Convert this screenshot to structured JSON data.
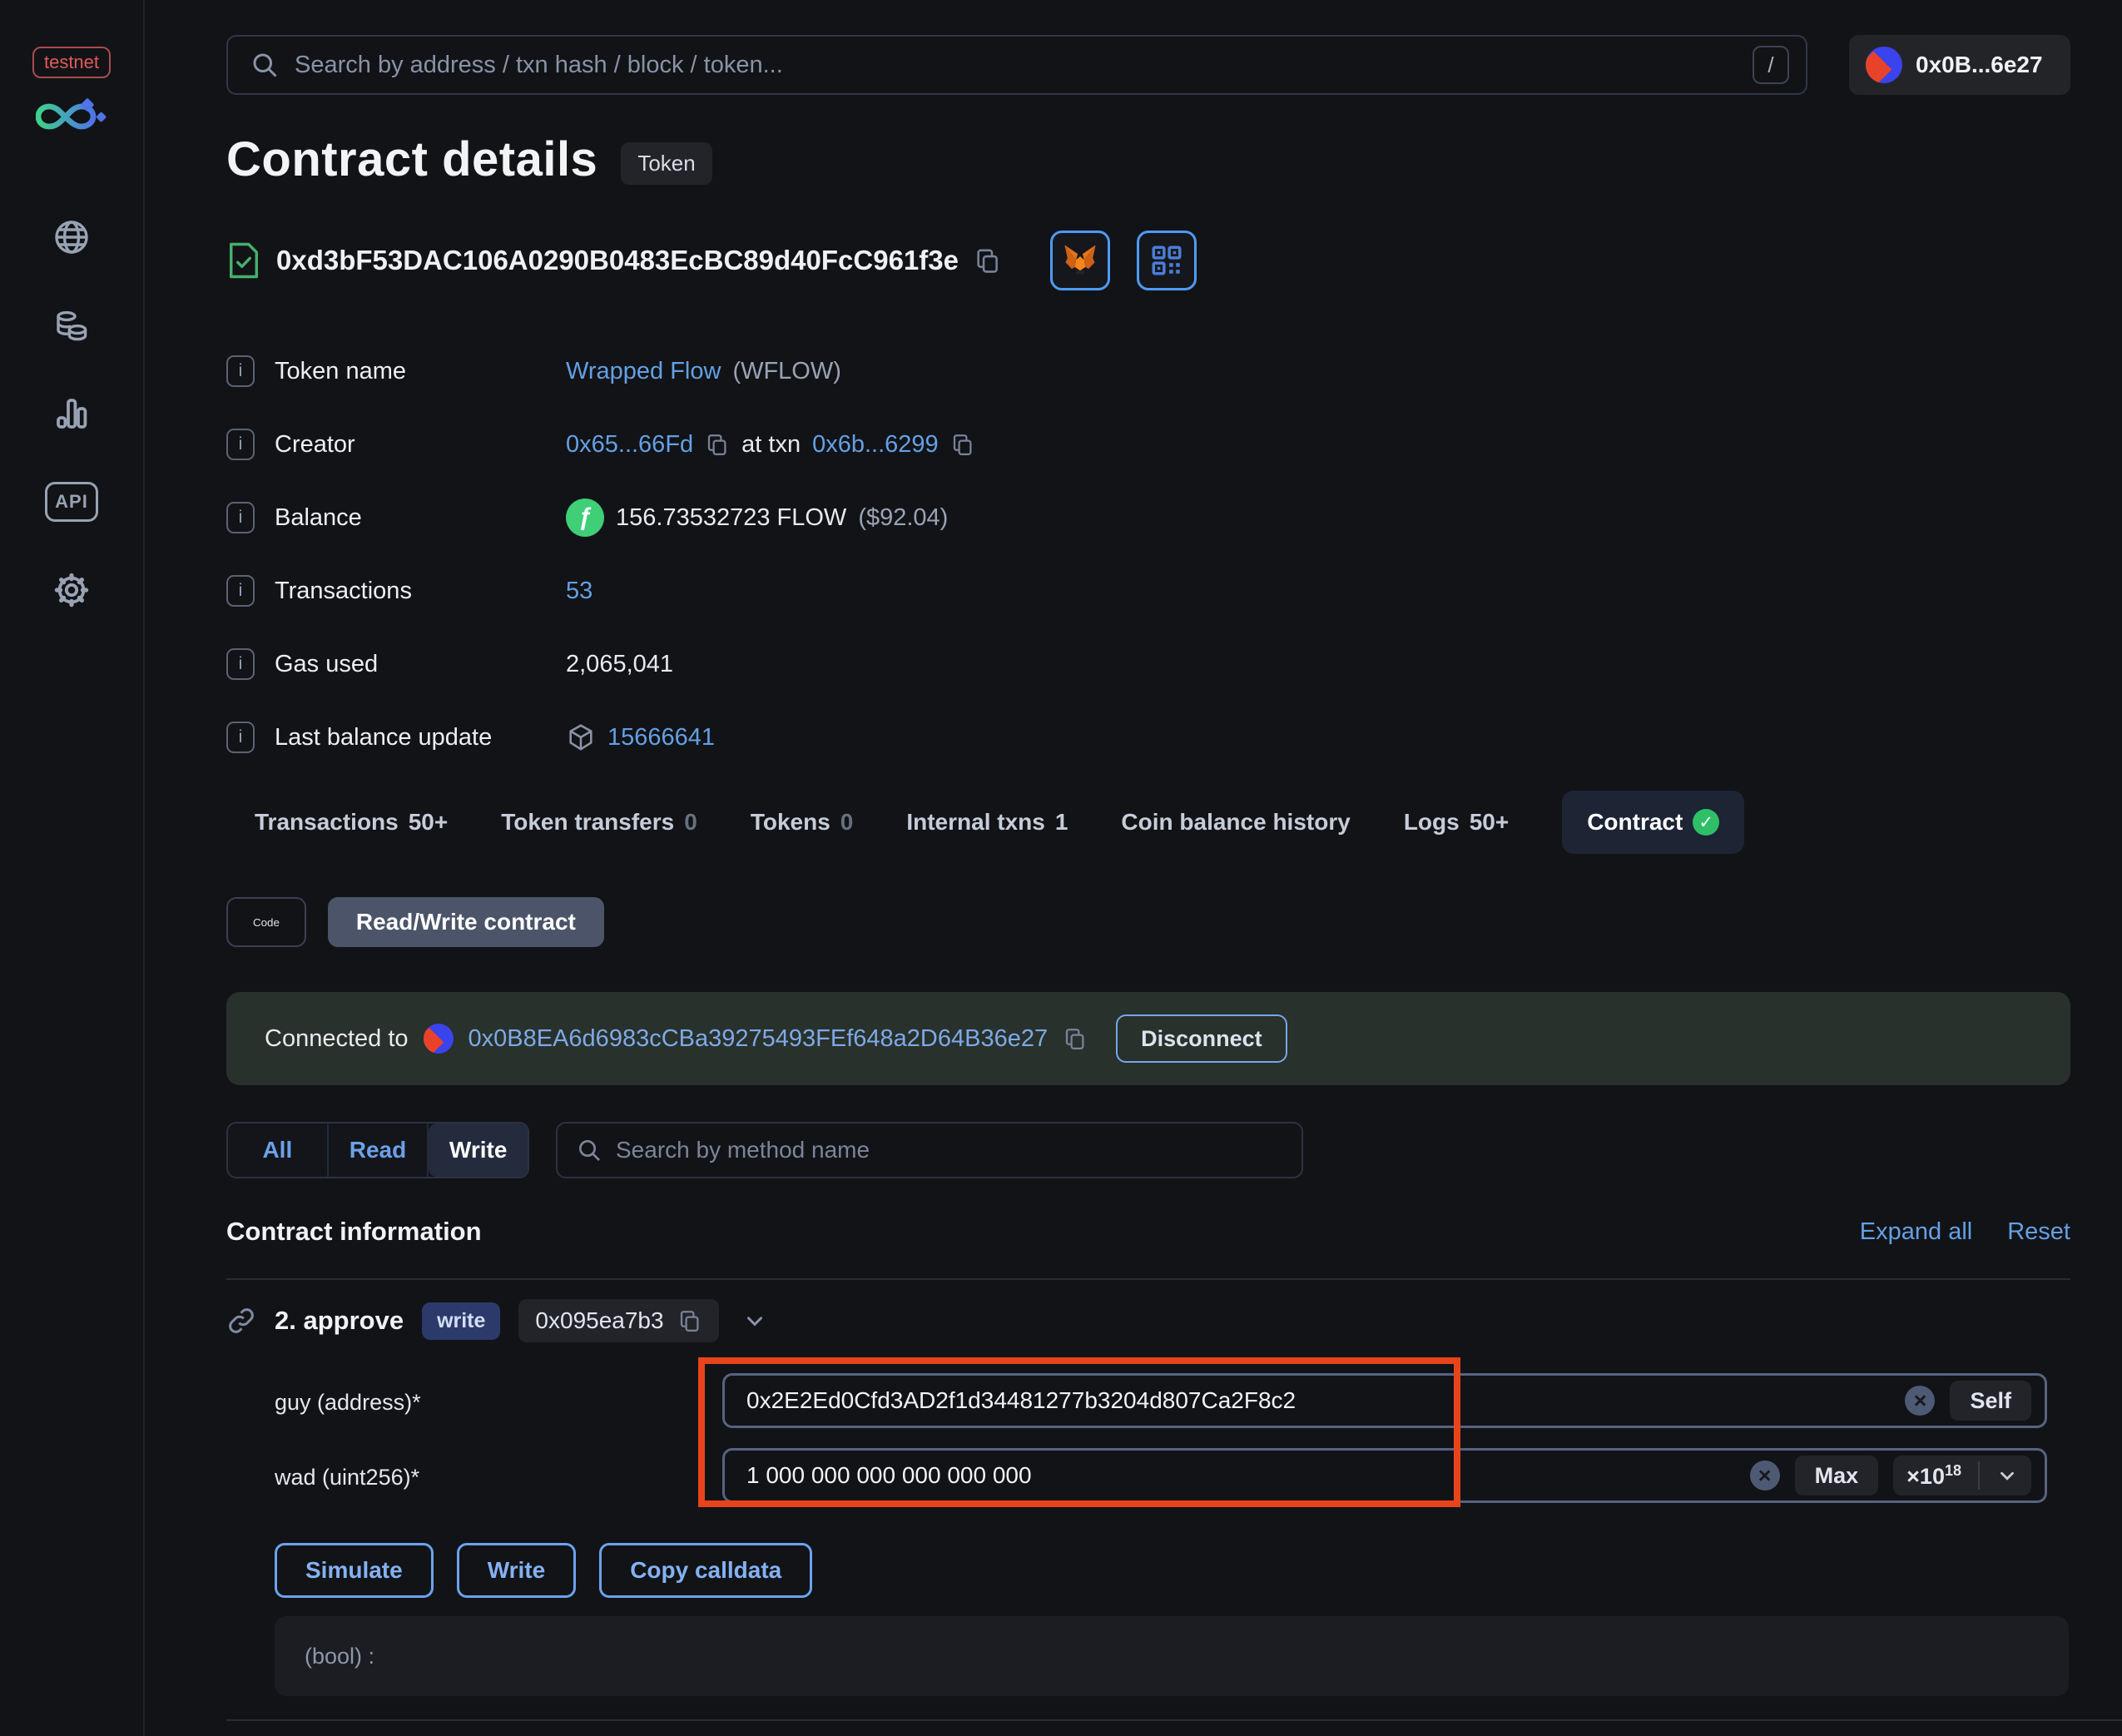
{
  "sidebar": {
    "network_badge": "testnet",
    "api_label": "API"
  },
  "topbar": {
    "search_placeholder": "Search by address / txn hash / block / token...",
    "shortcut_key": "/",
    "account_label": "0x0B...6e27"
  },
  "header": {
    "title": "Contract details",
    "badge": "Token",
    "address": "0xd3bF53DAC106A0290B0483EcBC89d40FcC961f3e"
  },
  "info": {
    "token_name": {
      "label": "Token name",
      "value": "Wrapped Flow",
      "symbol": "(WFLOW)"
    },
    "creator": {
      "label": "Creator",
      "address": "0x65...66Fd",
      "connector": "at txn",
      "txn": "0x6b...6299"
    },
    "balance": {
      "label": "Balance",
      "value": "156.73532723 FLOW",
      "usd": "($92.04)"
    },
    "transactions": {
      "label": "Transactions",
      "value": "53"
    },
    "gas_used": {
      "label": "Gas used",
      "value": "2,065,041"
    },
    "last_balance_update": {
      "label": "Last balance update",
      "value": "15666641"
    }
  },
  "tabs": [
    {
      "label": "Transactions",
      "count": "50+"
    },
    {
      "label": "Token transfers",
      "count": "0"
    },
    {
      "label": "Tokens",
      "count": "0"
    },
    {
      "label": "Internal txns",
      "count": "1"
    },
    {
      "label": "Coin balance history",
      "count": ""
    },
    {
      "label": "Logs",
      "count": "50+"
    },
    {
      "label": "Contract",
      "count": ""
    }
  ],
  "subtabs": {
    "code": "Code",
    "read_write": "Read/Write contract"
  },
  "connection": {
    "prefix": "Connected to",
    "address": "0x0B8EA6d6983cCBa39275493FEf648a2D64B36e27",
    "disconnect_label": "Disconnect"
  },
  "methods_filter": {
    "all": "All",
    "read": "Read",
    "write": "Write",
    "search_placeholder": "Search by method name"
  },
  "contract_info": {
    "title": "Contract information",
    "expand_all": "Expand all",
    "reset": "Reset"
  },
  "method": {
    "name": "2. approve",
    "type_badge": "write",
    "selector": "0x095ea7b3"
  },
  "fields": {
    "guy": {
      "label": "guy (address)*",
      "value": "0x2E2Ed0Cfd3AD2f1d34481277b3204d807Ca2F8c2",
      "self_label": "Self"
    },
    "wad": {
      "label": "wad (uint256)*",
      "value": "1 000 000 000 000 000 000",
      "max_label": "Max",
      "multiplier_base": "×10",
      "exponent": "18"
    }
  },
  "actions": {
    "simulate": "Simulate",
    "write": "Write",
    "copy_calldata": "Copy calldata"
  },
  "output": {
    "result": "(bool) :"
  },
  "colors": {
    "background": "#121317",
    "link_blue": "#64a0e4",
    "button_blue": "#6ba3ee",
    "success_green": "#2fbf67",
    "flow_green": "#3ecf77",
    "annotation_red": "#e8441c",
    "banner_green": "#28312b",
    "metamask_orange": "#f6851b",
    "testnet_red": "#e05b5b"
  }
}
